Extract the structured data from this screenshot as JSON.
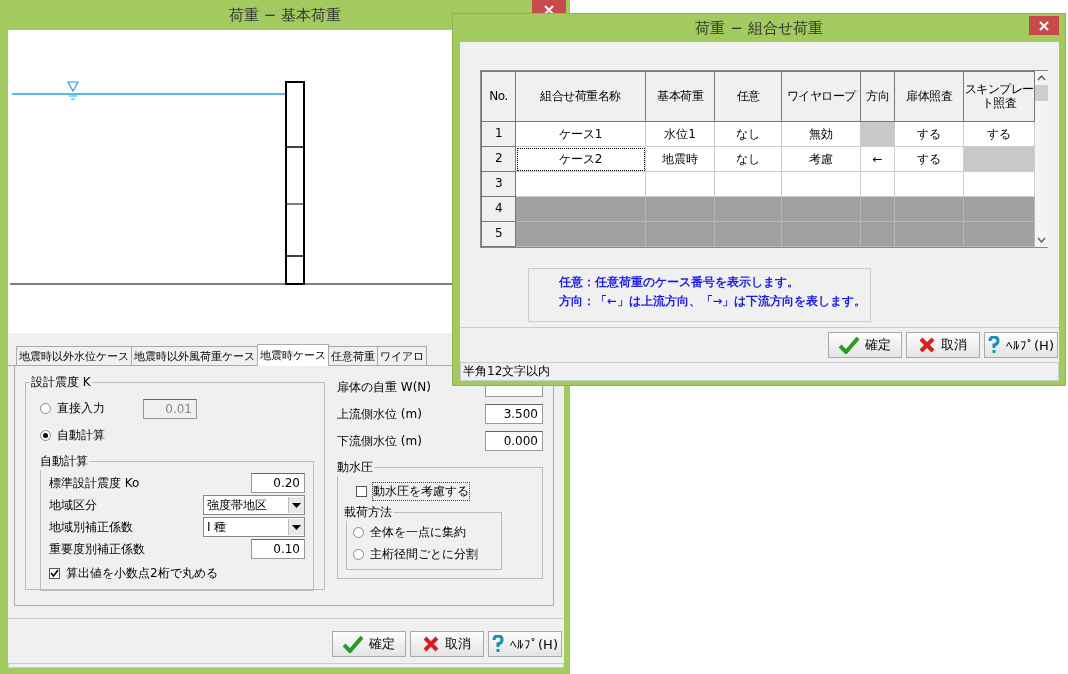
{
  "back_window": {
    "title": "荷重 − 基本荷重",
    "tabs": [
      {
        "label": "地震時以外水位ケース",
        "selected": false
      },
      {
        "label": "地震時以外風荷重ケース",
        "selected": false
      },
      {
        "label": "地震時ケース",
        "selected": true
      },
      {
        "label": "任意荷重",
        "selected": false
      },
      {
        "label": "ワイアロ",
        "selected": false
      }
    ],
    "seismic_group": {
      "legend": "設計震度 K",
      "modes": [
        {
          "label": "直接入力",
          "selected": false,
          "value": "0.01",
          "disabled": true
        },
        {
          "label": "自動計算",
          "selected": true
        }
      ],
      "auto": {
        "legend": "自動計算",
        "fields": [
          {
            "kind": "input",
            "label": "標準設計震度 Ko",
            "value": "0.20"
          },
          {
            "kind": "select",
            "label": "地域区分",
            "value": "強度帯地区"
          },
          {
            "kind": "select",
            "label": "地域別補正係数",
            "value": "I 種"
          },
          {
            "kind": "input",
            "label": "重要度別補正係数",
            "value": "0.10"
          }
        ],
        "round": {
          "label": "算出値を小数点2桁で丸める",
          "checked": true
        }
      }
    },
    "right_fields": [
      {
        "label": "扉体の自重 W(N)"
      },
      {
        "label": "上流側水位 (m)",
        "value": "3.500"
      },
      {
        "label": "下流側水位 (m)",
        "value": "0.000"
      }
    ],
    "hydro_group": {
      "legend": "動水圧",
      "consider": {
        "label": "動水圧を考慮する",
        "checked": false
      },
      "method": {
        "legend": "載荷方法",
        "options": [
          {
            "label": "全体を一点に集約",
            "selected": false
          },
          {
            "label": "主桁径間ごとに分割",
            "selected": false
          }
        ]
      }
    },
    "buttons": [
      "確定",
      "取消",
      "ﾍﾙﾌﾟ(H)"
    ]
  },
  "front_window": {
    "title": "荷重 − 組合せ荷重",
    "table": {
      "columns": [
        "No.",
        "組合せ荷重名称",
        "基本荷重",
        "任意",
        "ワイヤロープ",
        "方向",
        "扉体照査",
        "スキンプレート照査"
      ],
      "rows": [
        {
          "no": "1",
          "disabled": false,
          "cells": [
            {
              "text": "ケース1",
              "shaded": false,
              "focused": false
            },
            {
              "text": "水位1",
              "shaded": false,
              "focused": false
            },
            {
              "text": "なし",
              "shaded": false,
              "focused": false
            },
            {
              "text": "無効",
              "shaded": false,
              "focused": false
            },
            {
              "shaded": true,
              "focused": false
            },
            {
              "text": "する",
              "shaded": false,
              "focused": false
            },
            {
              "text": "する",
              "shaded": false,
              "focused": false
            }
          ]
        },
        {
          "no": "2",
          "disabled": false,
          "cells": [
            {
              "text": "ケース2",
              "shaded": false,
              "focused": true
            },
            {
              "text": "地震時",
              "shaded": false,
              "focused": false
            },
            {
              "text": "なし",
              "shaded": false,
              "focused": false
            },
            {
              "text": "考慮",
              "shaded": false,
              "focused": false
            },
            {
              "text": "←",
              "shaded": false,
              "focused": false
            },
            {
              "text": "する",
              "shaded": false,
              "focused": false
            },
            {
              "shaded": true,
              "focused": false
            }
          ]
        },
        {
          "no": "3",
          "disabled": false
        },
        {
          "no": "4",
          "disabled": true
        },
        {
          "no": "5",
          "disabled": true
        }
      ]
    },
    "notes": [
      "任意：任意荷重のケース番号を表示します。",
      "方向：「←」は上流方向、「→」は下流方向を表します。"
    ],
    "buttons": [
      "確定",
      "取消",
      "ﾍﾙﾌﾟ(H)"
    ],
    "status_bar": "半角12文字以内"
  }
}
